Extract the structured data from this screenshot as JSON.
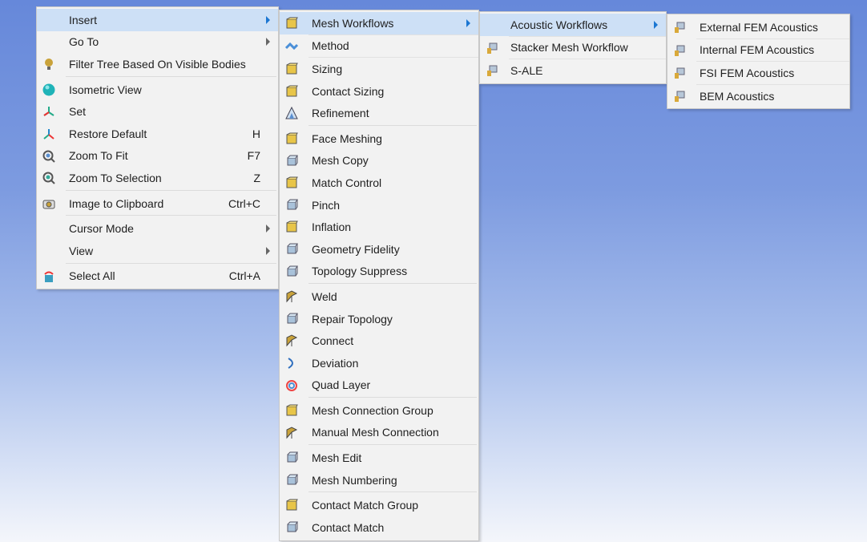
{
  "colors": {
    "highlight": "#cde0f6",
    "menu_bg": "#f2f2f2",
    "arrow_active": "#1b76d2"
  },
  "menus": [
    {
      "id": "context-menu",
      "items": [
        {
          "label": "Insert",
          "submenu": true,
          "highlighted": true
        },
        {
          "label": "Go To",
          "submenu": true
        },
        {
          "label": "Filter Tree Based On Visible Bodies",
          "icon": "lightbulb-icon"
        },
        {
          "sep": true
        },
        {
          "label": "Isometric View",
          "icon": "sphere-icon"
        },
        {
          "label": "Set",
          "icon": "axes-set-icon"
        },
        {
          "label": "Restore Default",
          "icon": "axes-restore-icon",
          "shortcut": "H"
        },
        {
          "label": "Zoom To Fit",
          "icon": "zoom-fit-icon",
          "shortcut": "F7"
        },
        {
          "label": "Zoom To Selection",
          "icon": "zoom-selection-icon",
          "shortcut": "Z"
        },
        {
          "sep": true
        },
        {
          "label": "Image to Clipboard",
          "icon": "camera-icon",
          "shortcut": "Ctrl+C"
        },
        {
          "sep": true
        },
        {
          "label": "Cursor Mode",
          "submenu": true
        },
        {
          "label": "View",
          "submenu": true
        },
        {
          "sep": true
        },
        {
          "label": "Select All",
          "icon": "select-all-icon",
          "shortcut": "Ctrl+A"
        }
      ]
    },
    {
      "id": "insert-submenu",
      "items": [
        {
          "label": "Mesh Workflows",
          "icon": "mesh-workflows-icon",
          "submenu": true,
          "highlighted": true
        },
        {
          "line": true
        },
        {
          "label": "Method",
          "icon": "method-icon"
        },
        {
          "line": true
        },
        {
          "label": "Sizing",
          "icon": "sizing-icon"
        },
        {
          "label": "Contact Sizing",
          "icon": "contact-sizing-icon"
        },
        {
          "label": "Refinement",
          "icon": "refinement-icon"
        },
        {
          "sep": true
        },
        {
          "label": "Face Meshing",
          "icon": "face-meshing-icon"
        },
        {
          "label": "Mesh Copy",
          "icon": "mesh-copy-icon"
        },
        {
          "label": "Match Control",
          "icon": "match-control-icon"
        },
        {
          "label": "Pinch",
          "icon": "pinch-icon"
        },
        {
          "label": "Inflation",
          "icon": "inflation-icon"
        },
        {
          "label": "Geometry Fidelity",
          "icon": "geometry-fidelity-icon"
        },
        {
          "label": "Topology Suppress",
          "icon": "topology-suppress-icon"
        },
        {
          "sep": true
        },
        {
          "label": "Weld",
          "icon": "weld-icon"
        },
        {
          "label": "Repair Topology",
          "icon": "repair-topology-icon"
        },
        {
          "label": "Connect",
          "icon": "connect-icon"
        },
        {
          "label": "Deviation",
          "icon": "deviation-icon"
        },
        {
          "label": "Quad Layer",
          "icon": "quad-layer-icon"
        },
        {
          "sep": true
        },
        {
          "label": "Mesh Connection Group",
          "icon": "mesh-connection-group-icon"
        },
        {
          "label": "Manual Mesh Connection",
          "icon": "manual-mesh-connection-icon"
        },
        {
          "sep": true
        },
        {
          "label": "Mesh Edit",
          "icon": "mesh-edit-icon"
        },
        {
          "label": "Mesh Numbering",
          "icon": "mesh-numbering-icon"
        },
        {
          "sep": true
        },
        {
          "label": "Contact Match Group",
          "icon": "contact-match-group-icon"
        },
        {
          "label": "Contact Match",
          "icon": "contact-match-icon"
        }
      ]
    },
    {
      "id": "mesh-workflows-submenu",
      "items": [
        {
          "label": "Acoustic Workflows",
          "submenu": true,
          "highlighted": true
        },
        {
          "line": true
        },
        {
          "label": "Stacker Mesh Workflow",
          "icon": "workflow-icon"
        },
        {
          "line": true
        },
        {
          "label": "S-ALE",
          "icon": "workflow-icon"
        }
      ]
    },
    {
      "id": "acoustic-workflows-submenu",
      "items": [
        {
          "label": "External FEM Acoustics",
          "icon": "workflow-icon"
        },
        {
          "line": true
        },
        {
          "label": "Internal FEM Acoustics",
          "icon": "workflow-icon"
        },
        {
          "line": true
        },
        {
          "label": "FSI FEM Acoustics",
          "icon": "workflow-icon"
        },
        {
          "line": true
        },
        {
          "label": "BEM Acoustics",
          "icon": "workflow-icon"
        }
      ]
    }
  ]
}
